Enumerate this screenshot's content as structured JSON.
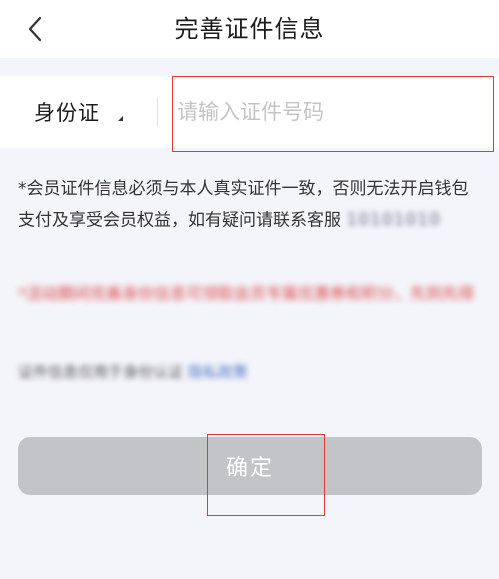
{
  "header": {
    "title": "完善证件信息",
    "back_icon": "chevron-left-icon"
  },
  "form": {
    "id_type_label": "身份证",
    "id_input_placeholder": "请输入证件号码",
    "id_input_value": ""
  },
  "notes": {
    "note1_text": "*会员证件信息必须与本人真实证件一致，否则无法开启钱包支付及享受会员权益，如有疑问请联系客服",
    "note1_phone_obscured": "10101010",
    "note2_obscured": "*活动期间完善身份信息可领取会员专属优惠券和积分，先到先得",
    "note3_obscured": "证件信息仅用于身份认证",
    "note3_link_obscured": "隐私政策"
  },
  "confirm": {
    "label": "确定"
  },
  "colors": {
    "background": "#f4f5fa",
    "button_disabled": "#c3c4c7",
    "notice_red": "#e0474a",
    "annotation_red": "#e23a3a",
    "placeholder_gray": "#c4c4c4"
  }
}
